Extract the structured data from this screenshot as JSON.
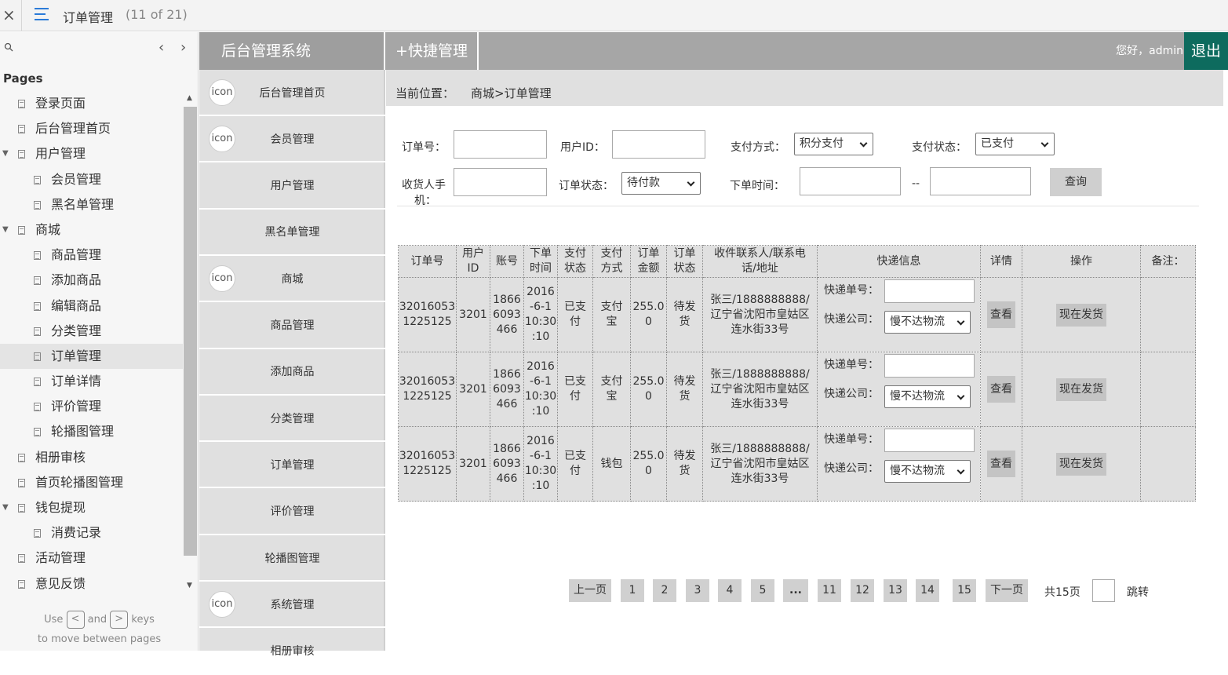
{
  "topbar": {
    "title": "订单管理",
    "count": "(11 of 21)",
    "close_glyph": "×"
  },
  "pages_panel": {
    "header": "Pages",
    "items": [
      {
        "label": "登录页面",
        "level": 0,
        "arrow": ""
      },
      {
        "label": "后台管理首页",
        "level": 0,
        "arrow": ""
      },
      {
        "label": "用户管理",
        "level": 0,
        "arrow": "▼"
      },
      {
        "label": "会员管理",
        "level": 1,
        "arrow": ""
      },
      {
        "label": "黑名单管理",
        "level": 1,
        "arrow": ""
      },
      {
        "label": "商城",
        "level": 0,
        "arrow": "▼"
      },
      {
        "label": "商品管理",
        "level": 1,
        "arrow": ""
      },
      {
        "label": "添加商品",
        "level": 1,
        "arrow": ""
      },
      {
        "label": "编辑商品",
        "level": 1,
        "arrow": ""
      },
      {
        "label": "分类管理",
        "level": 1,
        "arrow": ""
      },
      {
        "label": "订单管理",
        "level": 1,
        "arrow": "",
        "selected": true
      },
      {
        "label": "订单详情",
        "level": 1,
        "arrow": ""
      },
      {
        "label": "评价管理",
        "level": 1,
        "arrow": ""
      },
      {
        "label": "轮播图管理",
        "level": 1,
        "arrow": ""
      },
      {
        "label": "相册审核",
        "level": 0,
        "arrow": ""
      },
      {
        "label": "首页轮播图管理",
        "level": 0,
        "arrow": ""
      },
      {
        "label": "钱包提现",
        "level": 0,
        "arrow": "▼"
      },
      {
        "label": "消费记录",
        "level": 1,
        "arrow": ""
      },
      {
        "label": "活动管理",
        "level": 0,
        "arrow": ""
      },
      {
        "label": "意见反馈",
        "level": 0,
        "arrow": ""
      }
    ],
    "hint_use": "Use",
    "hint_and": "and",
    "hint_keys": "keys",
    "hint_line2": "to move between pages",
    "key_prev": "<",
    "key_next": ">"
  },
  "header": {
    "brand": "后台管理系统",
    "quick": "+快捷管理",
    "greeting": "您好，admin",
    "logout": "退出"
  },
  "sidenav": [
    {
      "label": "后台管理首页",
      "icon": "icon"
    },
    {
      "label": "会员管理",
      "icon": "icon"
    },
    {
      "label": "用户管理",
      "icon": ""
    },
    {
      "label": "黑名单管理",
      "icon": ""
    },
    {
      "label": "商城",
      "icon": "icon"
    },
    {
      "label": "商品管理",
      "icon": ""
    },
    {
      "label": "添加商品",
      "icon": ""
    },
    {
      "label": "分类管理",
      "icon": ""
    },
    {
      "label": "订单管理",
      "icon": ""
    },
    {
      "label": "评价管理",
      "icon": ""
    },
    {
      "label": "轮播图管理",
      "icon": ""
    },
    {
      "label": "系统管理",
      "icon": "icon"
    },
    {
      "label": "相册审核",
      "icon": ""
    }
  ],
  "breadcrumb": {
    "label": "当前位置：",
    "path": "商城>订单管理"
  },
  "filters": {
    "order_no_label": "订单号：",
    "user_id_label": "用户ID：",
    "pay_method_label": "支付方式：",
    "pay_method_value": "积分支付",
    "pay_status_label": "支付状态：",
    "pay_status_value": "已支付",
    "phone_label_1": "收货人手",
    "phone_label_2": "机：",
    "order_status_label": "订单状态：",
    "order_status_value": "待付款",
    "order_time_label": "下单时间：",
    "range_sep": "--",
    "query_button": "查询"
  },
  "table": {
    "headers": [
      "订单号",
      "用户\nID",
      "账号",
      "下单\n时间",
      "支付\n状态",
      "支付\n方式",
      "订单\n金额",
      "订单\n状态",
      "收件联系人/联系电\n话/地址",
      "快递信息",
      "详情",
      "操作",
      "备注："
    ],
    "ship_no_label": "快递单号：",
    "ship_company_label": "快递公司：",
    "view_button": "查看",
    "ship_button": "现在发货",
    "rows": [
      {
        "order_no": "32016053\n1225125",
        "user_id": "3201",
        "account": "1866\n6093\n466",
        "time": "2016\n-6-1\n10:30\n:10",
        "pay_status": "已支\n付",
        "pay_method": "支付\n宝",
        "amount": "255.0\n0",
        "status": "待发\n货",
        "contact": "张三/1888888888/\n辽宁省沈阳市皇姑区\n连水街33号",
        "company": "慢不达物流",
        "note": ""
      },
      {
        "order_no": "32016053\n1225125",
        "user_id": "3201",
        "account": "1866\n6093\n466",
        "time": "2016\n-6-1\n10:30\n:10",
        "pay_status": "已支\n付",
        "pay_method": "支付\n宝",
        "amount": "255.0\n0",
        "status": "待发\n货",
        "contact": "张三/1888888888/\n辽宁省沈阳市皇姑区\n连水街33号",
        "company": "慢不达物流",
        "note": ""
      },
      {
        "order_no": "32016053\n1225125",
        "user_id": "3201",
        "account": "1866\n6093\n466",
        "time": "2016\n-6-1\n10:30\n:10",
        "pay_status": "已支\n付",
        "pay_method": "钱包",
        "amount": "255.0\n0",
        "status": "待发\n货",
        "contact": "张三/1888888888/\n辽宁省沈阳市皇姑区\n连水街33号",
        "company": "慢不达物流",
        "note": ""
      }
    ]
  },
  "pager": {
    "prev": "上一页",
    "pages": [
      "1",
      "2",
      "3",
      "4",
      "5",
      "...",
      "11",
      "12",
      "13",
      "14",
      "15"
    ],
    "next": "下一页",
    "total": "共15页",
    "jump": "跳转"
  }
}
